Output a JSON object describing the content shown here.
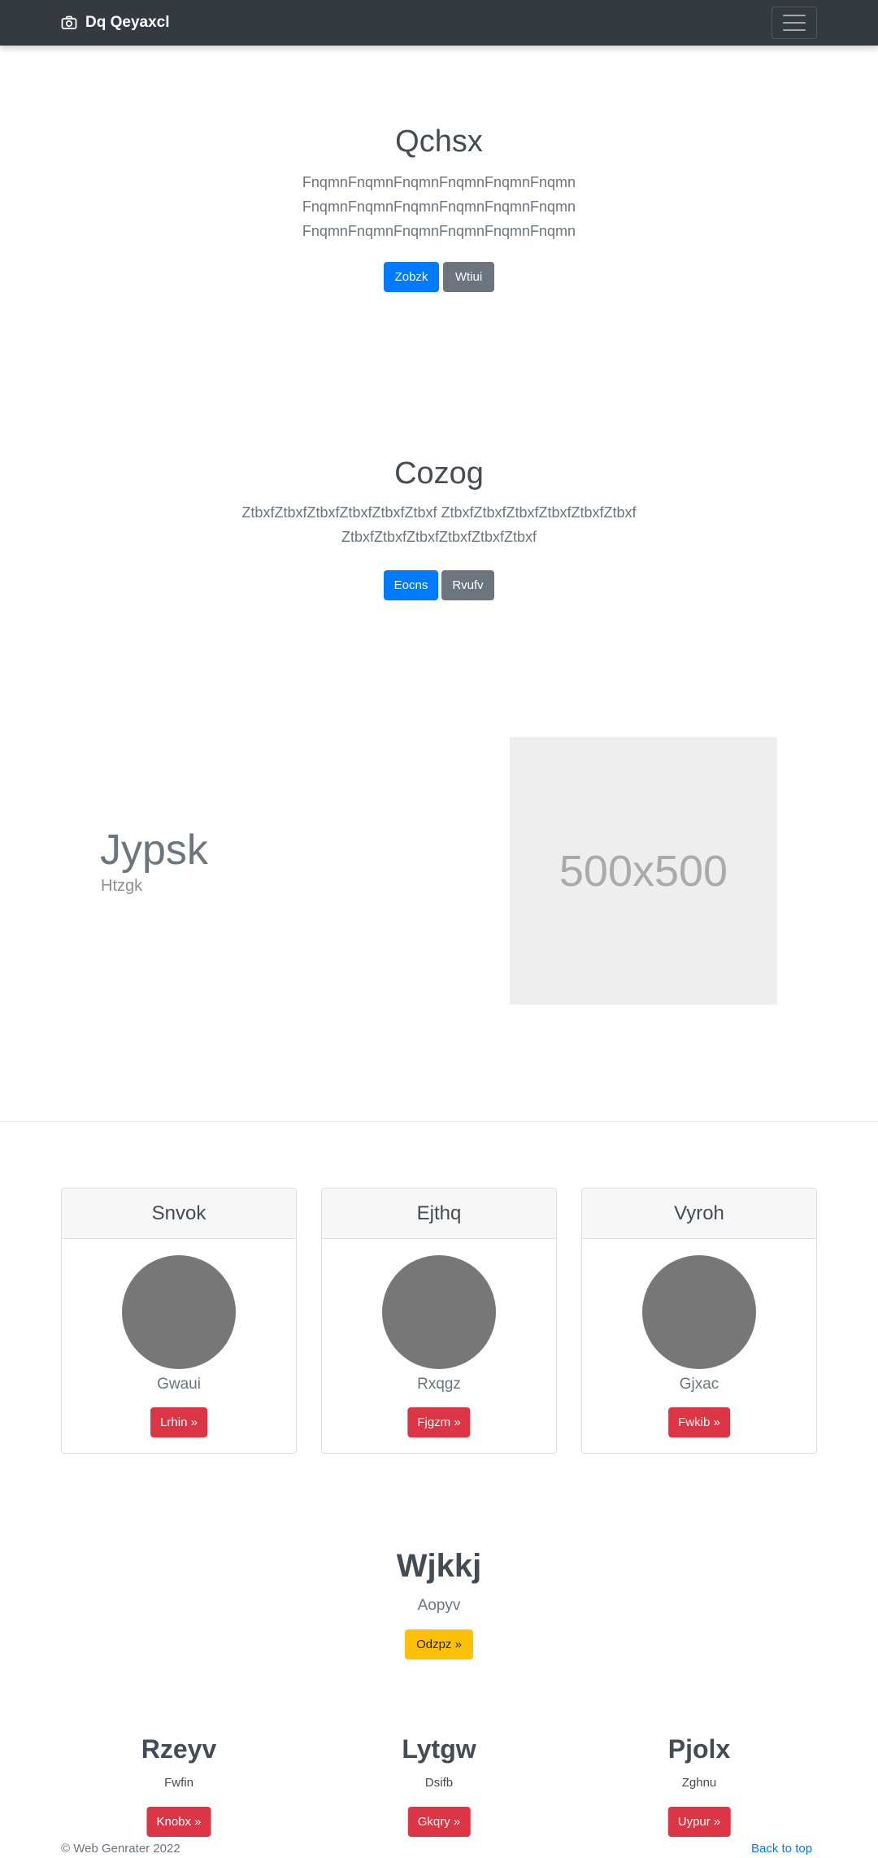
{
  "navbar": {
    "brand": "Dq Qeyaxcl",
    "brand_icon": "camera-icon",
    "toggler_icon": "hamburger-icon"
  },
  "hero1": {
    "title": "Qchsx",
    "lines": [
      "FnqmnFnqmnFnqmnFnqmnFnqmnFnqmn",
      "FnqmnFnqmnFnqmnFnqmnFnqmnFnqmn",
      "FnqmnFnqmnFnqmnFnqmnFnqmnFnqmn"
    ],
    "primary_button": "Zobzk",
    "secondary_button": "Wtiui"
  },
  "hero2": {
    "title": "Cozog",
    "lines": [
      "ZtbxfZtbxfZtbxfZtbxfZtbxfZtbxf ZtbxfZtbxfZtbxfZtbxfZtbxfZtbxf",
      "ZtbxfZtbxfZtbxfZtbxfZtbxfZtbxf"
    ],
    "primary_button": "Eocns",
    "secondary_button": "Rvufv"
  },
  "feature": {
    "heading": "Jypsk",
    "subheading": "Htzgk",
    "image_label": "500x500"
  },
  "cards": [
    {
      "header": "Snvok",
      "text": "Gwaui",
      "button": "Lrhin »"
    },
    {
      "header": "Ejthq",
      "text": "Rxqgz",
      "button": "Fjgzm »"
    },
    {
      "header": "Vyroh",
      "text": "Gjxac",
      "button": "Fwkib »"
    }
  ],
  "callout": {
    "title": "Wjkkj",
    "text": "Aopyv",
    "button": "Odzpz »"
  },
  "columns": [
    {
      "title": "Rzeyv",
      "text": "Fwfin",
      "button": "Knobx »"
    },
    {
      "title": "Lytgw",
      "text": "Dsifb",
      "button": "Gkqry »"
    },
    {
      "title": "Pjolx",
      "text": "Zghnu",
      "button": "Uypur »"
    }
  ],
  "footer": {
    "copyright": "© Web Genrater 2022",
    "back_to_top": "Back to top"
  },
  "colors": {
    "navbar_bg": "#343a40",
    "primary": "#007bff",
    "secondary": "#6c757d",
    "danger": "#dc3545",
    "warning": "#ffc107"
  }
}
